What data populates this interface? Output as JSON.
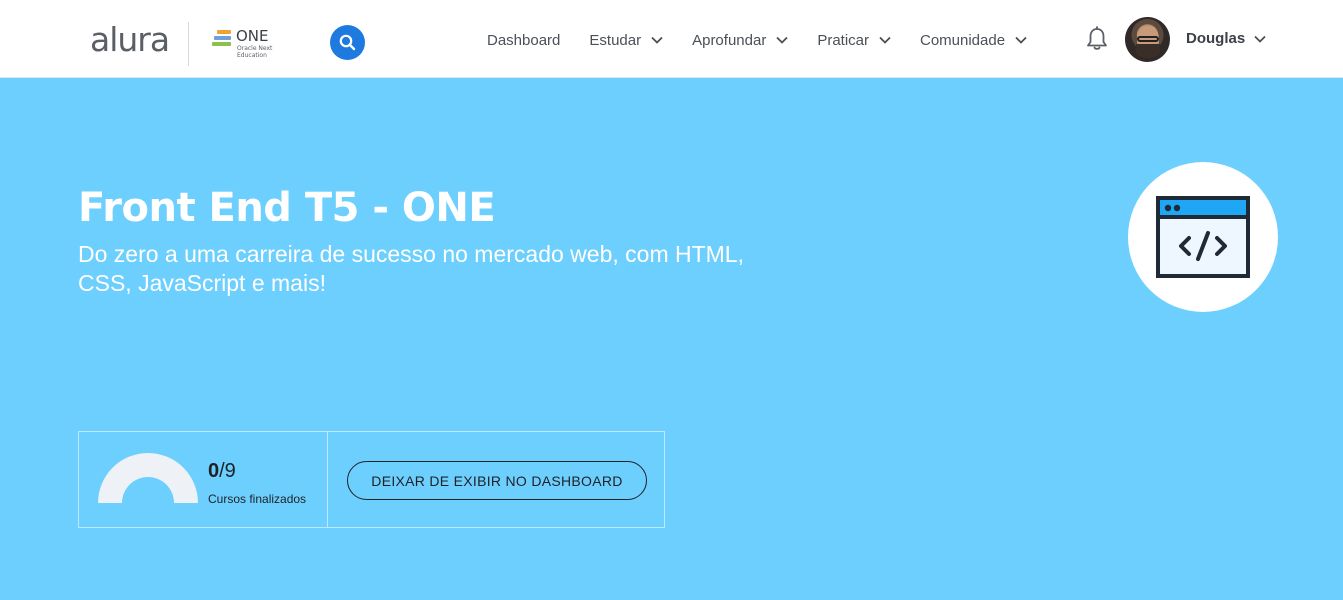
{
  "header": {
    "logo": "alura",
    "partner_logo": {
      "title": "ONE",
      "subtitle_line1": "Oracle Next",
      "subtitle_line2": "Education"
    },
    "search_icon": "search-icon",
    "nav": [
      {
        "label": "Dashboard",
        "has_dropdown": false
      },
      {
        "label": "Estudar",
        "has_dropdown": true
      },
      {
        "label": "Aprofundar",
        "has_dropdown": true
      },
      {
        "label": "Praticar",
        "has_dropdown": true
      },
      {
        "label": "Comunidade",
        "has_dropdown": true
      }
    ],
    "notification_icon": "bell-icon",
    "user": {
      "name": "Douglas"
    }
  },
  "hero": {
    "title": "Front End T5 - ONE",
    "subtitle": "Do zero a uma carreira de sucesso no mercado web, com HTML, CSS, JavaScript e mais!",
    "icon": "code-window-icon"
  },
  "progress": {
    "completed": "0",
    "total": "/9",
    "completed_fraction": 0,
    "label": "Cursos finalizados",
    "button_label": "DEIXAR DE EXIBIR NO DASHBOARD"
  },
  "colors": {
    "hero_background": "#6ccffe",
    "search_button": "#1f7ae0",
    "icon_accent": "#1fa6f5",
    "dark_text": "#1e2227"
  }
}
